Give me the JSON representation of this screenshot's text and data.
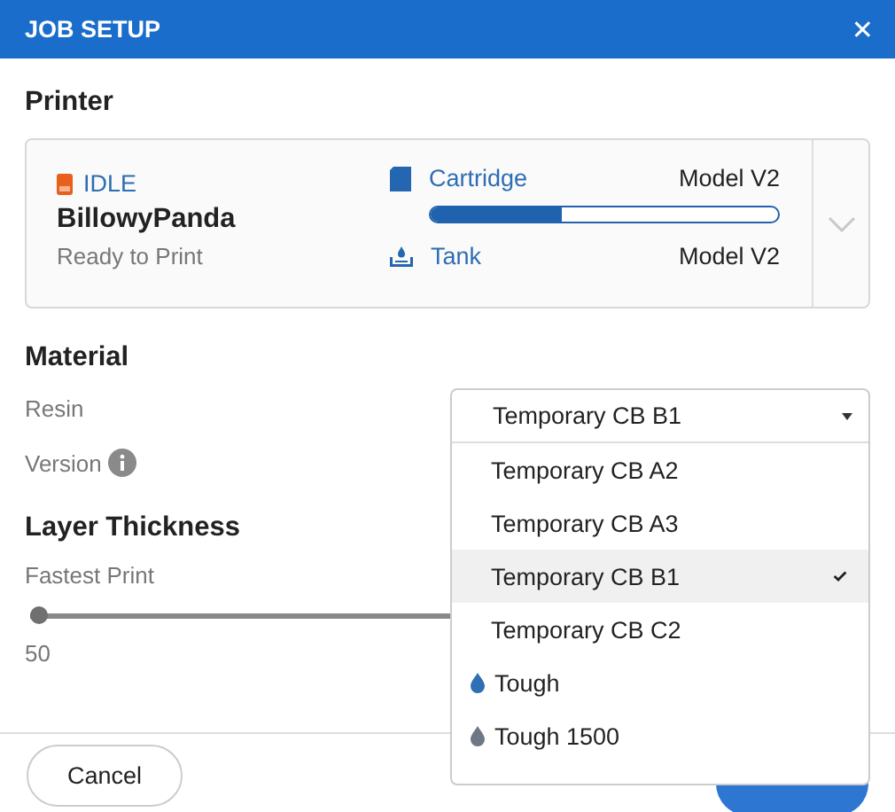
{
  "window": {
    "title": "JOB SETUP",
    "close": "✕"
  },
  "printer": {
    "heading": "Printer",
    "status": "IDLE",
    "name": "BillowyPanda",
    "state": "Ready to Print",
    "cartridge": {
      "label": "Cartridge",
      "model": "Model V2",
      "level": 0.38
    },
    "tank": {
      "label": "Tank",
      "model": "Model V2"
    }
  },
  "material": {
    "heading": "Material",
    "resin_label": "Resin",
    "version_label": "Version",
    "resin": {
      "value": "Temporary CB B1",
      "options": [
        {
          "label": "Temporary CB A2",
          "selected": false
        },
        {
          "label": "Temporary CB A3",
          "selected": false
        },
        {
          "label": "Temporary CB B1",
          "selected": true
        },
        {
          "label": "Temporary CB C2",
          "selected": false
        },
        {
          "label": "Tough",
          "selected": false,
          "color": "#2f6fb3"
        },
        {
          "label": "Tough 1500",
          "selected": false,
          "color": "#6d7884"
        }
      ]
    }
  },
  "layer": {
    "heading": "Layer Thickness",
    "label": "Fastest Print",
    "level": 0,
    "value": "50"
  },
  "buttons": {
    "cancel": "Cancel"
  }
}
